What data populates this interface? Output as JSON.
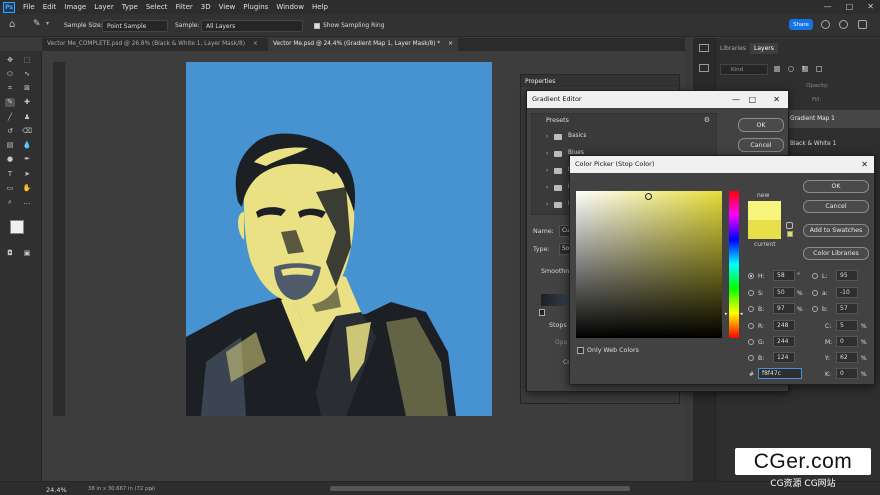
{
  "menu": [
    "File",
    "Edit",
    "Image",
    "Layer",
    "Type",
    "Select",
    "Filter",
    "3D",
    "View",
    "Plugins",
    "Window",
    "Help"
  ],
  "options": {
    "sample_size_label": "Sample Size:",
    "sample_size_value": "Point Sample",
    "sample_label": "Sample:",
    "sample_value": "All Layers",
    "show_ring": "Show Sampling Ring",
    "share": "Share"
  },
  "tabs": [
    {
      "label": "Vector Me_COMPLETE.psd @ 26.8% (Black & White 1, Layer Mask/8)",
      "close": "×"
    },
    {
      "label": "Vector Me.psd @ 24.4% (Gradient Map 1, Layer Mask/8) *",
      "close": "×"
    }
  ],
  "status": {
    "zoom": "24.4%",
    "doc_info": "38 in x 30.667 in (72 ppi)"
  },
  "panels": {
    "libraries": "Libraries",
    "layers": "Layers",
    "properties": "Properties",
    "kind": "Kind",
    "opacity": "Opacity:",
    "fill": "Fill:",
    "layer1": "Gradient Map 1",
    "layer2": "Black & White 1"
  },
  "gradient_editor": {
    "title": "Gradient Editor",
    "presets": "Presets",
    "ok": "OK",
    "cancel": "Cancel",
    "folders": [
      "Basics",
      "Blues",
      "Pu",
      "Pi",
      "Re"
    ],
    "name_label": "Name:",
    "name_value": "Cu",
    "type_label": "Type:",
    "type_value": "So",
    "smoothness": "Smoothn",
    "stops": "Stops",
    "opacity": "Opa",
    "color": "Co"
  },
  "color_picker": {
    "title": "Color Picker (Stop Color)",
    "ok": "OK",
    "cancel": "Cancel",
    "add_swatches": "Add to Swatches",
    "color_libraries": "Color Libraries",
    "new_label": "new",
    "current_label": "current",
    "only_web": "Only Web Colors",
    "new_color": "#f8f47c",
    "current_color": "#e8e04a",
    "H": "58",
    "H_unit": "°",
    "S": "50",
    "S_unit": "%",
    "B": "97",
    "B_unit": "%",
    "R": "248",
    "G": "244",
    "Bv": "124",
    "L": "95",
    "a": "-10",
    "b": "57",
    "C": "5",
    "M": "0",
    "Y": "62",
    "K": "0",
    "pct": "%",
    "hex_label": "#",
    "hex": "f8f47c"
  },
  "watermark": {
    "big": "CGer.com",
    "small": "CG资源 CG网站"
  },
  "colors": {
    "art_bg": "#4792d0",
    "art_yellow": "#e9e184",
    "art_dark": "#1c1f24",
    "accent": "#1473e6"
  }
}
